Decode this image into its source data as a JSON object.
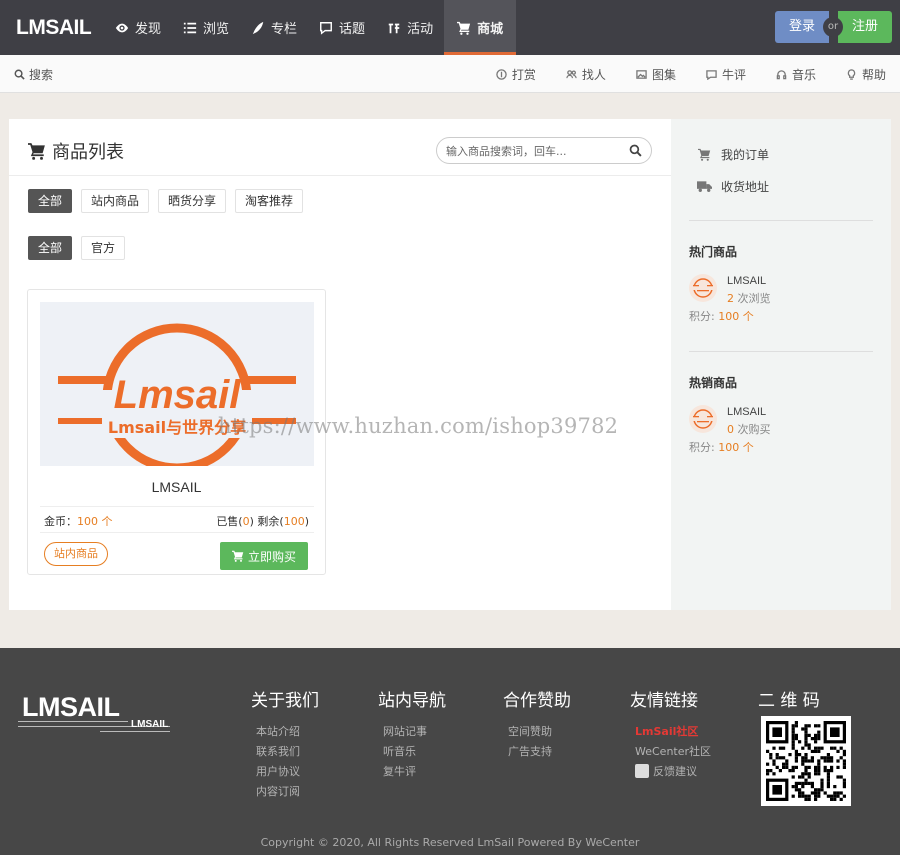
{
  "header": {
    "logo": "LMSAIL",
    "nav": [
      {
        "label": "发现",
        "icon": "eye-icon"
      },
      {
        "label": "浏览",
        "icon": "list-icon"
      },
      {
        "label": "专栏",
        "icon": "pen-icon"
      },
      {
        "label": "话题",
        "icon": "chat-icon"
      },
      {
        "label": "活动",
        "icon": "activity-icon"
      },
      {
        "label": "商城",
        "icon": "cart-icon",
        "active": true
      }
    ],
    "login": "登录",
    "or": "or",
    "register": "注册"
  },
  "subbar": {
    "search": "搜索",
    "links": [
      {
        "label": "打赏",
        "icon": "coin-icon"
      },
      {
        "label": "找人",
        "icon": "people-icon"
      },
      {
        "label": "图集",
        "icon": "image-icon"
      },
      {
        "label": "牛评",
        "icon": "comment-icon"
      },
      {
        "label": "音乐",
        "icon": "headphones-icon"
      },
      {
        "label": "帮助",
        "icon": "bulb-icon"
      }
    ]
  },
  "main": {
    "title": "商品列表",
    "search_placeholder": "输入商品搜索词，回车...",
    "filter_row1": [
      "全部",
      "站内商品",
      "晒货分享",
      "淘客推荐"
    ],
    "filter_row2": [
      "全部",
      "官方"
    ],
    "product": {
      "image_text": "Lmsail",
      "image_subtext": "Lmsail与世界分享",
      "name": "LMSAIL",
      "price_label": "金币：",
      "price_value": "100 个",
      "sold_label": "已售(",
      "sold_value": "0",
      "remain_label": ") 剩余(",
      "remain_value": "100",
      "stock_end": ")",
      "badge": "站内商品",
      "buy": "立即购买"
    }
  },
  "watermark": "https://www.huzhan.com/ishop39782",
  "sidebar": {
    "links": [
      "我的订单",
      "收货地址"
    ],
    "hot_title": "热门商品",
    "hot": {
      "name": "LMSAIL",
      "count": "2",
      "count_label": " 次浏览",
      "pts_label": "积分: ",
      "pts_value": "100 个"
    },
    "best_title": "热销商品",
    "best": {
      "name": "LMSAIL",
      "count": "0",
      "count_label": " 次购买",
      "pts_label": "积分: ",
      "pts_value": "100 个"
    }
  },
  "footer": {
    "logo": "LMSAIL",
    "sublogo": "LMSAIL",
    "cols": [
      {
        "title": "关于我们",
        "links": [
          "本站介绍",
          "联系我们",
          "用户协议",
          "内容订阅"
        ]
      },
      {
        "title": "站内导航",
        "links": [
          "网站记事",
          "听音乐",
          "复牛评"
        ]
      },
      {
        "title": "合作赞助",
        "links": [
          "空间赞助",
          "广告支持"
        ]
      },
      {
        "title": "友情链接",
        "links": [
          "LmSail社区",
          "WeCenter社区",
          "反馈建议"
        ]
      },
      {
        "title": "二 维 码",
        "links": []
      }
    ],
    "copyright": "Copyright © 2020, All Rights Reserved LmSail Powered By WeCenter"
  },
  "colors": {
    "accent": "#e06a36",
    "green": "#5cb85c",
    "blue": "#6f8dc5",
    "dark": "#3f3f45"
  }
}
